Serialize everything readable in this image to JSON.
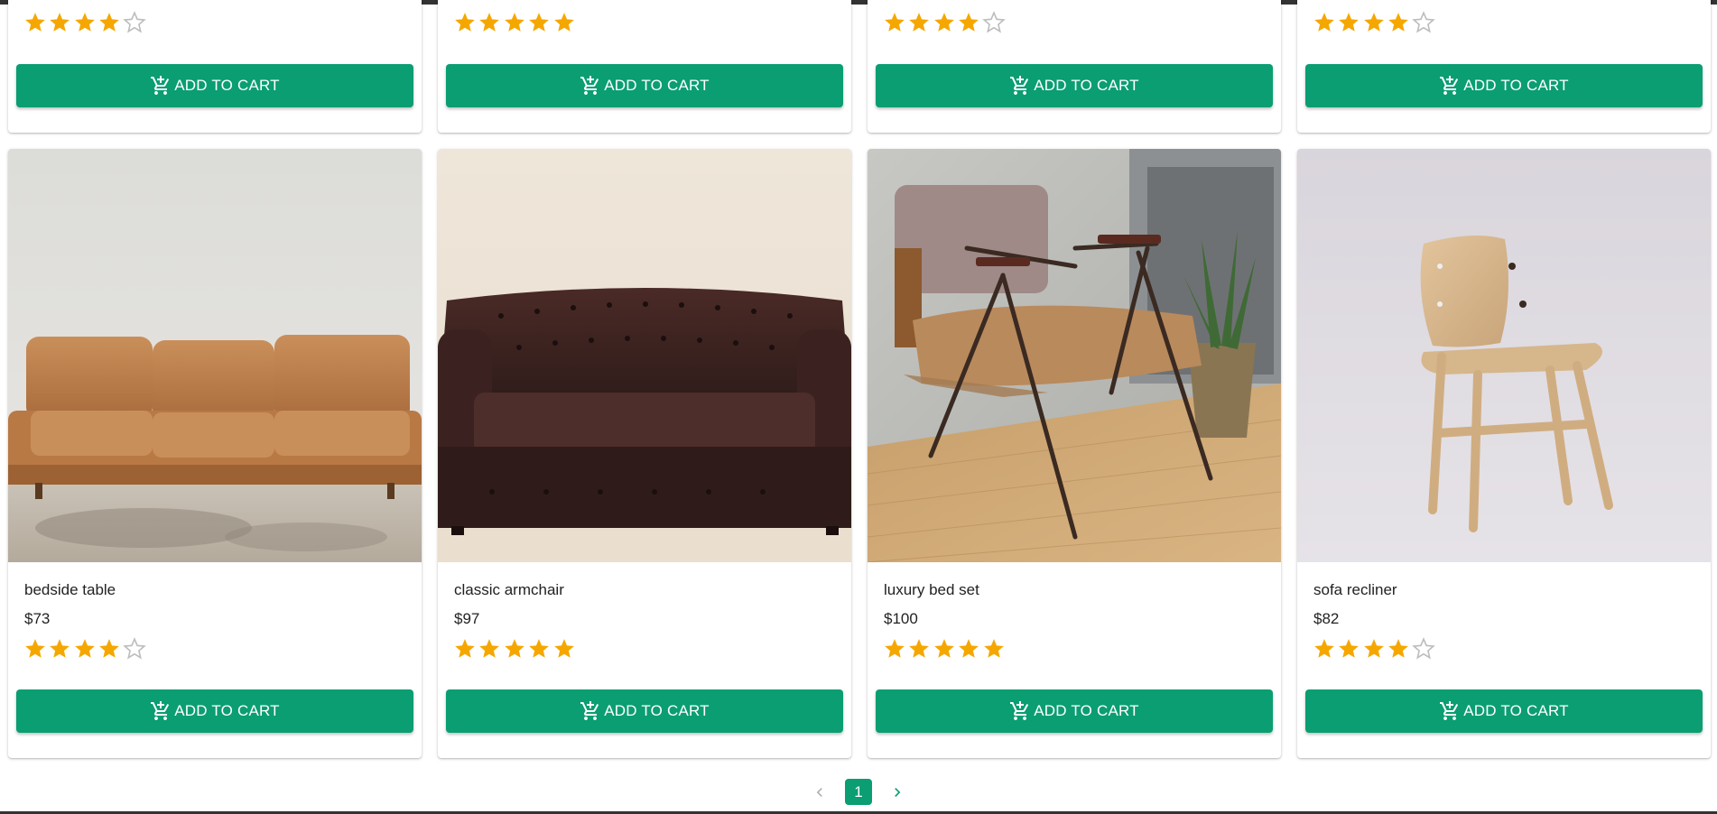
{
  "colors": {
    "accent": "#0a9e72",
    "star_filled": "#f5a700",
    "star_empty": "#bdbdbd",
    "top_bar": "#333333"
  },
  "top_row": [
    {
      "rating": 4,
      "max_rating": 5,
      "button_label": "ADD TO CART",
      "button_icon": "add-shopping-cart-icon"
    },
    {
      "rating": 5,
      "max_rating": 5,
      "button_label": "ADD TO CART",
      "button_icon": "add-shopping-cart-icon"
    },
    {
      "rating": 4,
      "max_rating": 5,
      "button_label": "ADD TO CART",
      "button_icon": "add-shopping-cart-icon"
    },
    {
      "rating": 4,
      "max_rating": 5,
      "button_label": "ADD TO CART",
      "button_icon": "add-shopping-cart-icon"
    }
  ],
  "products": [
    {
      "name": "bedside table",
      "price": "$73",
      "rating": 4,
      "max_rating": 5,
      "button_label": "ADD TO CART",
      "image": "tan-leather-sofa-photo"
    },
    {
      "name": "classic armchair",
      "price": "$97",
      "rating": 5,
      "max_rating": 5,
      "button_label": "ADD TO CART",
      "image": "chesterfield-sofa-photo"
    },
    {
      "name": "luxury bed set",
      "price": "$100",
      "rating": 5,
      "max_rating": 5,
      "button_label": "ADD TO CART",
      "image": "lounge-chair-with-plant-photo"
    },
    {
      "name": "sofa recliner",
      "price": "$82",
      "rating": 4,
      "max_rating": 5,
      "button_label": "ADD TO CART",
      "image": "wooden-chair-photo"
    }
  ],
  "pagination": {
    "current_page": "1",
    "prev_icon": "chevron-left-icon",
    "next_icon": "chevron-right-icon"
  }
}
